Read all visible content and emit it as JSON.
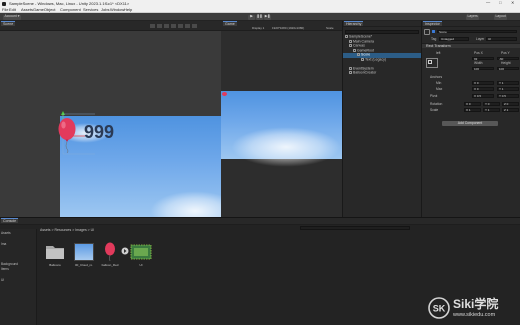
{
  "window": {
    "title": "SampleScene - Windows, Mac, Linux - Unity 2023.1.1f1c1* <DX11>",
    "minimize": "—",
    "maximize": "□",
    "close": "✕"
  },
  "menu": [
    "File",
    "Edit",
    "Assets",
    "GameObject",
    "Component",
    "Services",
    "Jobs",
    "Window",
    "Help"
  ],
  "toolbar": {
    "account": "Account ▾",
    "play": "▶",
    "pause": "❚❚",
    "step": "▶❚",
    "layers": "Layers",
    "layout": "Layout"
  },
  "scene": {
    "tab": "Scene",
    "label_text": "999"
  },
  "game": {
    "tab": "Game",
    "display": "Display 1",
    "resolution": "1920*1080 (1920x1080)",
    "scale": "Scale"
  },
  "hierarchy": {
    "tab": "Hierarchy",
    "items": [
      {
        "label": "SampleScene*",
        "depth": 0
      },
      {
        "label": "Main Camera",
        "depth": 1
      },
      {
        "label": "Canvas",
        "depth": 1
      },
      {
        "label": "GameRoot",
        "depth": 2
      },
      {
        "label": "Score",
        "depth": 3
      },
      {
        "label": "Text (Legacy)",
        "depth": 4
      },
      {
        "label": "EventSystem",
        "depth": 1
      },
      {
        "label": "BalloonCreator",
        "depth": 1
      }
    ],
    "selected_index": 4
  },
  "inspector": {
    "tab": "Inspector",
    "object_name": "Score",
    "tag_label": "Tag",
    "tag_value": "Untagged",
    "layer_label": "Layer",
    "layer_value": "UI",
    "component": "Rect Transform",
    "anchor_label": "left",
    "pos_x_label": "Pos X",
    "pos_x": "93",
    "pos_y_label": "Pos Y",
    "pos_y": "-60",
    "width_label": "Width",
    "width": "100",
    "height_label": "Height",
    "height": "100",
    "anchors_label": "Anchors",
    "min_label": "Min",
    "min_x": "X 0",
    "min_y": "Y 1",
    "max_label": "Max",
    "max_x": "X 0",
    "max_y": "Y 1",
    "pivot_label": "Pivot",
    "pivot_x": "X 0.5",
    "pivot_y": "Y 0.5",
    "rotation_label": "Rotation",
    "rot_x": "X 0",
    "rot_y": "Y 0",
    "rot_z": "Z 0",
    "scale_label": "Scale",
    "scale_x": "X 1",
    "scale_y": "Y 1",
    "scale_z": "Z 1",
    "add_component": "Add Component"
  },
  "project": {
    "tab": "Console",
    "breadcrumb": "Assets > Resources > Images > UI",
    "left_items": [
      "Assets",
      "Ima",
      "Background",
      "Items",
      "UI"
    ],
    "assets": [
      {
        "label": "Balloons",
        "icon": "folder-icon"
      },
      {
        "label": "00_Cloud_ro...",
        "icon": "cloud-image-icon"
      },
      {
        "label": "balloon_Red",
        "icon": "balloon-icon"
      },
      {
        "label": "UI",
        "icon": "ui-sprite-icon"
      }
    ]
  },
  "watermark": {
    "brand": "Siki学院",
    "url": "www.sikiedu.com"
  },
  "colors": {
    "accent": "#2c5d87",
    "sky_top": "#4f93e0",
    "balloon": "#e23a5c",
    "gizmo_green": "#4ecb3a",
    "gizmo_red": "#e04040"
  }
}
